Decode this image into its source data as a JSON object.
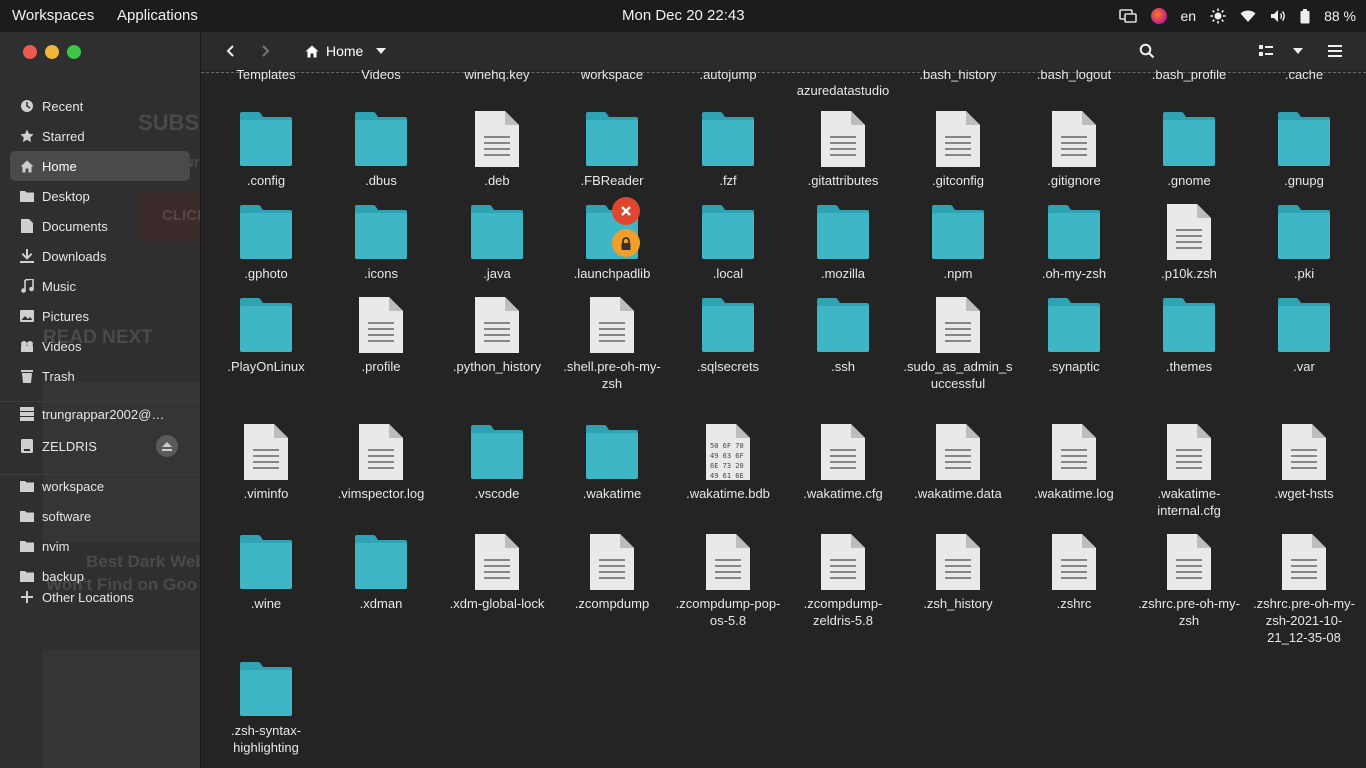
{
  "topbar": {
    "workspaces": "Workspaces",
    "applications": "Applications",
    "clock": "Mon Dec 20  22:43",
    "lang": "en",
    "battery": "88 %",
    "icons": [
      "screen-icon",
      "firefox-icon",
      "brightness-icon",
      "wifi-icon",
      "volume-icon",
      "battery-icon"
    ]
  },
  "sidebar": {
    "places": [
      {
        "label": "Recent",
        "icon": "clock-icon"
      },
      {
        "label": "Starred",
        "icon": "star-icon"
      },
      {
        "label": "Home",
        "icon": "home-icon",
        "active": true
      },
      {
        "label": "Desktop",
        "icon": "folder-icon"
      },
      {
        "label": "Documents",
        "icon": "document-icon"
      },
      {
        "label": "Downloads",
        "icon": "download-icon"
      },
      {
        "label": "Music",
        "icon": "music-icon"
      },
      {
        "label": "Pictures",
        "icon": "picture-icon"
      },
      {
        "label": "Videos",
        "icon": "video-icon"
      },
      {
        "label": "Trash",
        "icon": "trash-icon"
      }
    ],
    "devices": [
      {
        "label": "trungrappar2002@g...",
        "icon": "server-icon"
      },
      {
        "label": "ZELDRIS",
        "icon": "drive-icon"
      }
    ],
    "bookmarks": [
      {
        "label": "workspace",
        "icon": "folder-icon"
      },
      {
        "label": "software",
        "icon": "folder-icon"
      },
      {
        "label": "nvim",
        "icon": "folder-icon"
      },
      {
        "label": "backup",
        "icon": "folder-icon"
      }
    ],
    "other": "Other Locations"
  },
  "header": {
    "path_label": "Home"
  },
  "top_partial": [
    "Templates",
    "Videos",
    "winehq.key",
    "workspace",
    ".autojump",
    "azuredatastudio",
    ".bash_history",
    ".bash_logout",
    ".bash_profile",
    ".cache"
  ],
  "files": [
    [
      ".config",
      "folder"
    ],
    [
      ".dbus",
      "folder"
    ],
    [
      ".deb",
      "file"
    ],
    [
      ".FBReader",
      "folder"
    ],
    [
      ".fzf",
      "folder"
    ],
    [
      ".gitattributes",
      "file"
    ],
    [
      ".gitconfig",
      "file"
    ],
    [
      ".gitignore",
      "file"
    ],
    [
      ".gnome",
      "folder"
    ],
    [
      ".gnupg",
      "folder"
    ],
    [
      ".gphoto",
      "folder"
    ],
    [
      ".icons",
      "folder"
    ],
    [
      ".java",
      "folder"
    ],
    [
      ".launchpadlib",
      "folder-locked"
    ],
    [
      ".local",
      "folder"
    ],
    [
      ".mozilla",
      "folder"
    ],
    [
      ".npm",
      "folder"
    ],
    [
      ".oh-my-zsh",
      "folder"
    ],
    [
      ".p10k.zsh",
      "file"
    ],
    [
      ".pki",
      "folder"
    ],
    [
      ".PlayOnLinux",
      "folder"
    ],
    [
      ".profile",
      "file"
    ],
    [
      ".python_history",
      "file"
    ],
    [
      ".shell.pre-oh-my-zsh",
      "file"
    ],
    [
      ".sqlsecrets",
      "folder"
    ],
    [
      ".ssh",
      "folder"
    ],
    [
      ".sudo_as_admin_successful",
      "file"
    ],
    [
      ".synaptic",
      "folder"
    ],
    [
      ".themes",
      "folder"
    ],
    [
      ".var",
      "folder"
    ],
    [
      ".viminfo",
      "file"
    ],
    [
      ".vimspector.log",
      "file"
    ],
    [
      ".vscode",
      "folder"
    ],
    [
      ".wakatime",
      "folder"
    ],
    [
      ".wakatime.bdb",
      "hex"
    ],
    [
      ".wakatime.cfg",
      "file"
    ],
    [
      ".wakatime.data",
      "file"
    ],
    [
      ".wakatime.log",
      "file"
    ],
    [
      ".wakatime-internal.cfg",
      "file"
    ],
    [
      ".wget-hsts",
      "file"
    ],
    [
      ".wine",
      "folder"
    ],
    [
      ".xdman",
      "folder"
    ],
    [
      ".xdm-global-lock",
      "file"
    ],
    [
      ".zcompdump",
      "file"
    ],
    [
      ".zcompdump-pop-os-5.8",
      "file"
    ],
    [
      ".zcompdump-zeldris-5.8",
      "file"
    ],
    [
      ".zsh_history",
      "file"
    ],
    [
      ".zshrc",
      "file"
    ],
    [
      ".zshrc.pre-oh-my-zsh",
      "file"
    ],
    [
      ".zshrc.pre-oh-my-zsh-2021-10-21_12-35-08",
      "file"
    ],
    [
      ".zsh-syntax-highlighting",
      "folder"
    ]
  ],
  "hex_text": [
    "50 6F 70",
    "49 63 6F",
    "6E 73 20",
    "49 61 6E"
  ],
  "ghost_text": [
    "SUBS",
    "Join Our",
    "CLICK",
    "READ NEXT",
    "Best Dark Web",
    "Won't Find on Goo"
  ],
  "colors": {
    "folder": "#3fb6c6",
    "folder_tab": "#2fa3b3",
    "file": "#e9e9e9",
    "accent": "#2f8ee6"
  }
}
